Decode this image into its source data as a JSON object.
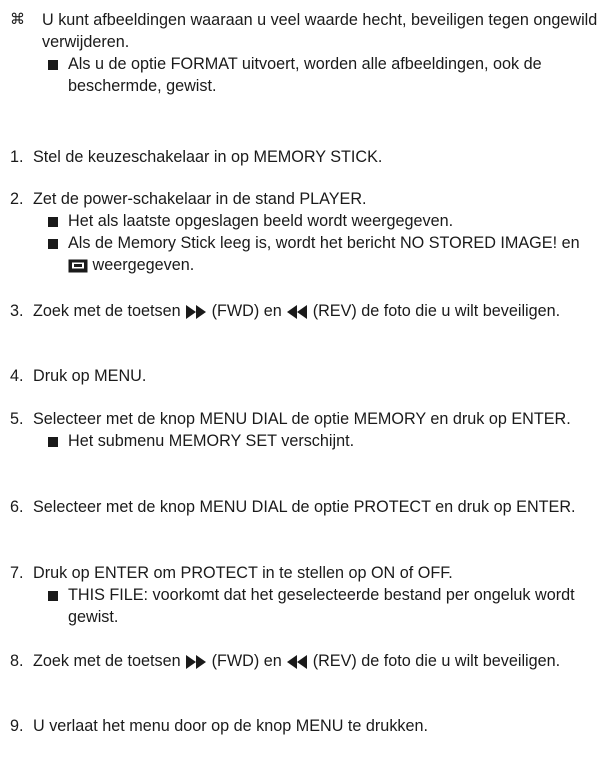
{
  "intro": {
    "symbol": "⌘",
    "text": "U kunt afbeeldingen waaraan u veel waarde hecht, beveiligen tegen ongewild verwijderen.",
    "bullet": "Als u de optie FORMAT uitvoert, worden alle afbeeldingen, ook de beschermde, gewist."
  },
  "steps": [
    {
      "num": "1.",
      "text": "Stel de keuzeschakelaar in op MEMORY STICK."
    },
    {
      "num": "2.",
      "text": "Zet de power-schakelaar in de stand PLAYER.",
      "bullets": [
        "Het als laatste opgeslagen beeld wordt weergegeven.",
        "Als de Memory Stick leeg is, wordt het bericht NO STORED IMAGE! en",
        "weergegeven."
      ]
    },
    {
      "num": "3.",
      "pre": "Zoek met de toetsen",
      "fwd": "(FWD) en",
      "rev": "(REV) de foto die u wilt beveiligen."
    },
    {
      "num": "4.",
      "text": "Druk op MENU."
    },
    {
      "num": "5.",
      "text": "Selecteer met de knop MENU DIAL de optie MEMORY en druk op ENTER.",
      "bullets": [
        "Het submenu MEMORY SET verschijnt."
      ]
    },
    {
      "num": "6.",
      "text": "Selecteer met de knop MENU DIAL de optie PROTECT en druk op ENTER."
    },
    {
      "num": "7.",
      "text": "Druk op ENTER om PROTECT in te stellen op ON of OFF.",
      "bullets": [
        "THIS FILE: voorkomt dat het geselecteerde bestand per ongeluk wordt gewist."
      ]
    },
    {
      "num": "8.",
      "pre": "Zoek met de toetsen",
      "fwd": "(FWD) en",
      "rev": "(REV) de foto die u wilt beveiligen."
    },
    {
      "num": "9.",
      "text": "U verlaat het menu door op de knop MENU te drukken."
    }
  ],
  "icons": {
    "fwd": "fast-forward-icon",
    "rev": "rewind-icon",
    "memory": "memory-stick-icon"
  }
}
